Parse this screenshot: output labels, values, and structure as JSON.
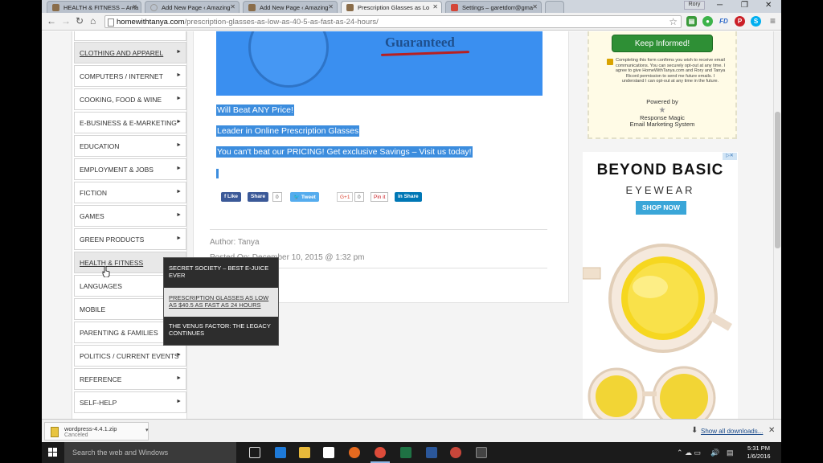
{
  "tabs": [
    {
      "label": "HEALTH & FITNESS – Ama",
      "color": "#8a6d4a"
    },
    {
      "label": "Add New Page ‹ Amazing",
      "color": "#999999"
    },
    {
      "label": "Add New Page ‹ Amazing",
      "color": "#8a6d4a"
    },
    {
      "label": "Prescription Glasses as Lo",
      "color": "#8a6d4a"
    },
    {
      "label": "Settings – garetdorr@gma",
      "color": "#d44638"
    }
  ],
  "profile_name": "Rory",
  "url": {
    "domain": "homewithtanya.com",
    "path": "/prescription-glasses-as-low-as-40-5-as-fast-as-24-hours/"
  },
  "extensions": [
    "FD"
  ],
  "categories": [
    "CLOTHING AND APPAREL",
    "COMPUTERS / INTERNET",
    "COOKING, FOOD & WINE",
    "E-BUSINESS & E-MARKETING",
    "EDUCATION",
    "EMPLOYMENT & JOBS",
    "FICTION",
    "GAMES",
    "GREEN PRODUCTS",
    "HEALTH & FITNESS",
    "LANGUAGES",
    "MOBILE",
    "PARENTING & FAMILIES",
    "POLITICS / CURRENT EVENTS",
    "REFERENCE",
    "SELF-HELP"
  ],
  "hero_text": "Guaranteed",
  "selected_lines": [
    "Will Beat ANY Price!",
    "Leader in Online Prescription Glasses",
    "You can't beat our PRICING!  Get exclusive Savings – Visit us today!"
  ],
  "share": {
    "like": "Like",
    "share": "Share",
    "fb_count": "0",
    "tweet": "Tweet",
    "gplus": "G+1",
    "gplus_count": "0",
    "pin": "Pin it",
    "linkedin": "Share"
  },
  "author_line": "Author: Tanya",
  "posted_line": "Posted On: December 10, 2015 @ 1:32 pm",
  "submenu": [
    "SECRET SOCIETY – BEST E-JUICE EVER",
    "PRESCRIPTION GLASSES AS LOW AS $40.5 AS FAST AS 24 HOURS",
    "THE VENUS FACTOR: THE LEGACY CONTINUES"
  ],
  "optin": {
    "button": "Keep Informed!",
    "fine_print": "Completing this form confirms you wish to receive email communications. You can securely opt-out at any time. I agree to give HomeWithTanya.com and Rory and Tanya Ricord permission to send me future emails. I understand I can opt-out at any time in the future.",
    "powered": "Powered by",
    "brand1": "Response Magic",
    "brand2": "Email Marketing System"
  },
  "ad": {
    "title": "BEYOND BASIC",
    "subtitle": "EYEWEAR",
    "cta": "SHOP NOW",
    "choice": "▷✕"
  },
  "download": {
    "name": "wordpress-4.4.1.zip",
    "status": "Canceled",
    "show_all": "Show all downloads..."
  },
  "taskbar": {
    "search": "Search the web and Windows",
    "time": "5:31 PM",
    "date": "1/6/2016"
  }
}
